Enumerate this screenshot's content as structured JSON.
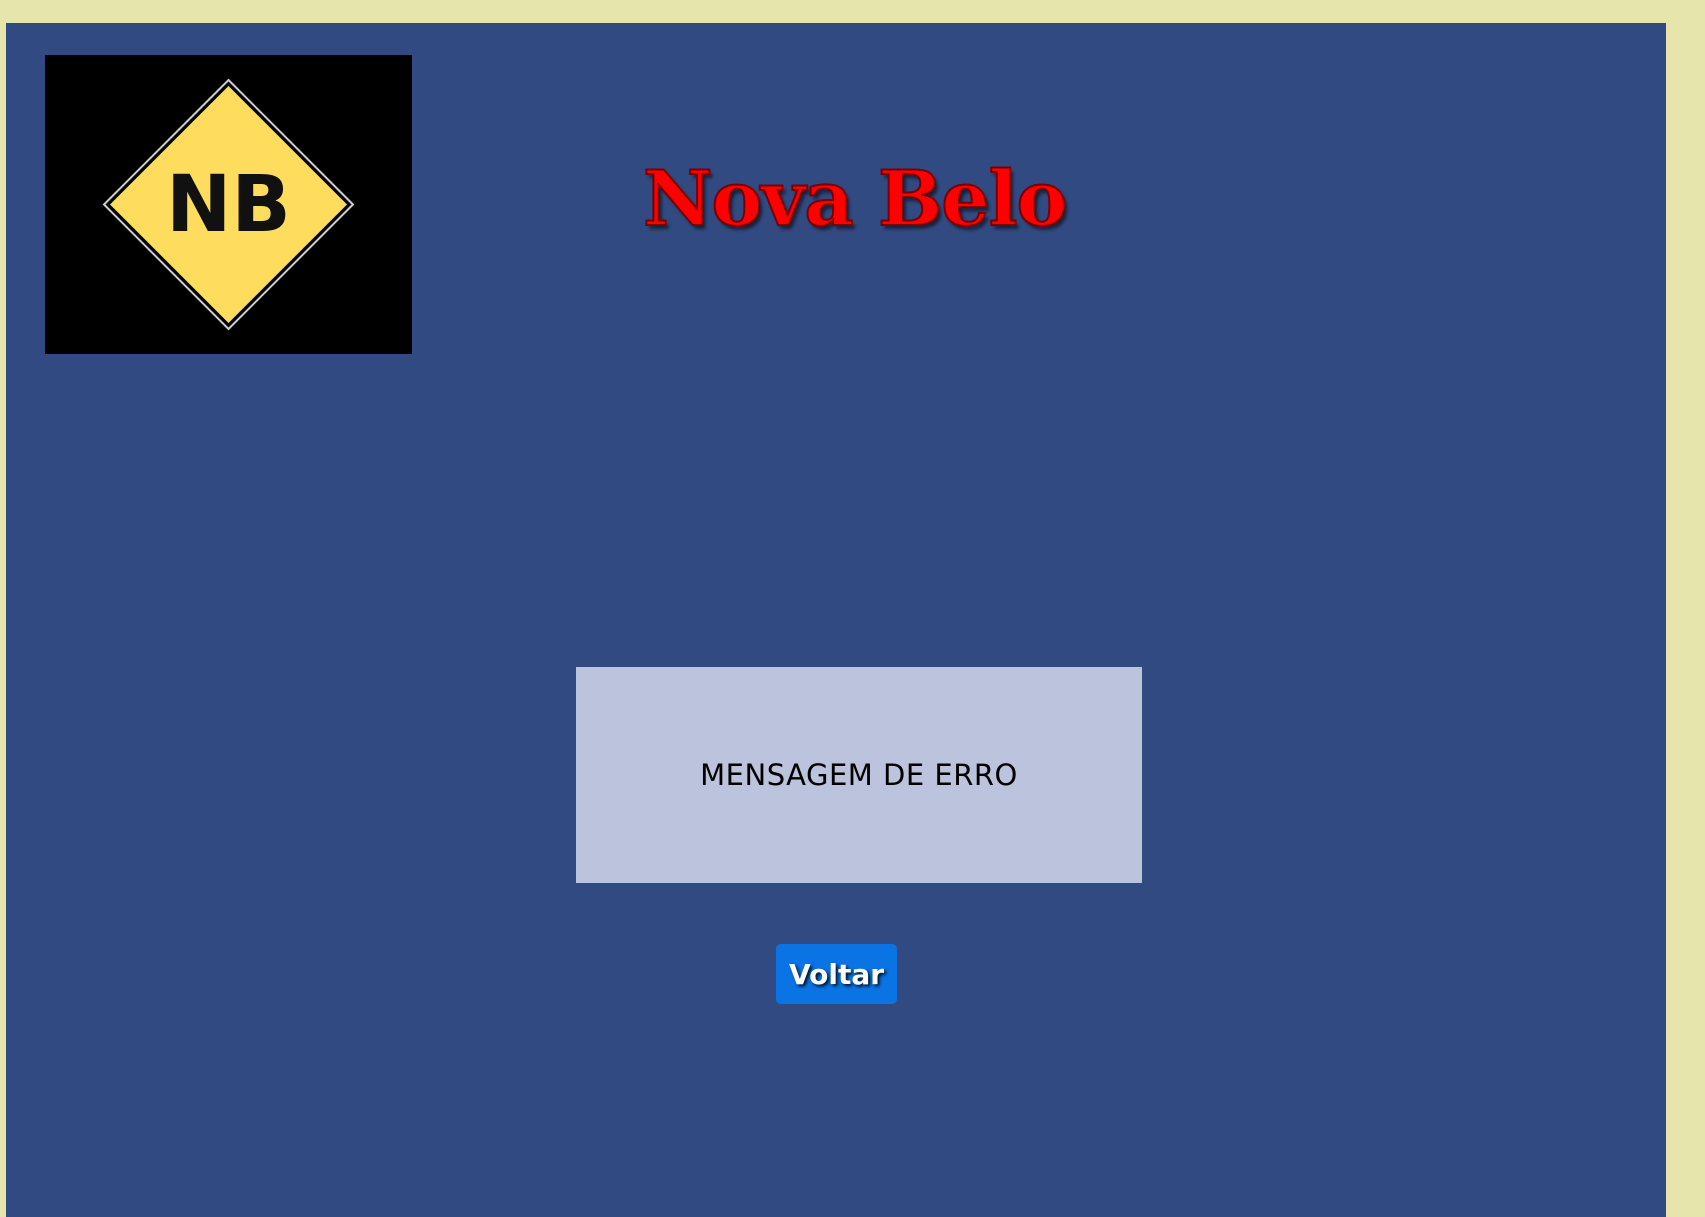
{
  "colors": {
    "page_background": "#e6e5ab",
    "panel_background": "#324a82",
    "title_red": "#ff0000",
    "error_box_background": "#bcc3dc",
    "button_blue": "#0b74e5",
    "logo_yellow": "#fedd5e",
    "logo_black": "#000000"
  },
  "logo": {
    "text": "NB",
    "icon": "nb-diamond-logo"
  },
  "header": {
    "title": "Nova Belo"
  },
  "error": {
    "message": "MENSAGEM DE ERRO"
  },
  "actions": {
    "back_label": "Voltar"
  }
}
